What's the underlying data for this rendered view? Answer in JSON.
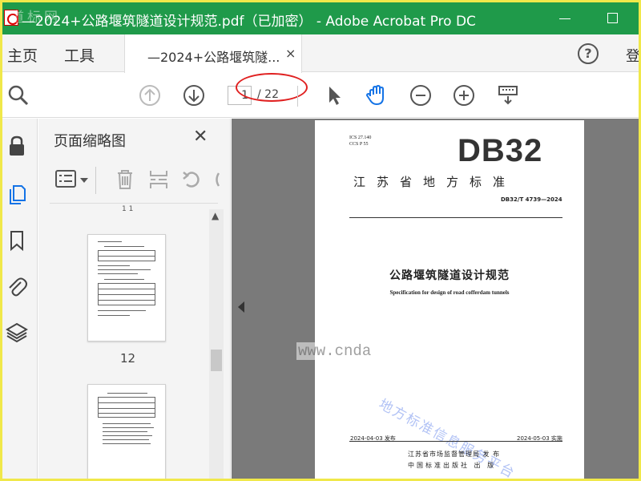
{
  "titlebar": {
    "watermark": "道标网",
    "title": "—2024+公路堰筑隧道设计规范.pdf（已加密） - Adobe Acrobat Pro DC"
  },
  "menu": {
    "home": "主页",
    "tools": "工具",
    "tab_label": "—2024+公路堰筑隧...",
    "tab_close": "×",
    "help": "?",
    "login": "登"
  },
  "toolbar": {
    "page_current": "1",
    "page_total": "/ 22",
    "icons": [
      "search-icon",
      "page-up-icon",
      "page-down-icon",
      "select-arrow-icon",
      "hand-tool-icon",
      "zoom-out-icon",
      "zoom-in-icon",
      "keyboard-icon"
    ]
  },
  "rail": {
    "icons": [
      "lock-icon",
      "page-thumbnails-icon",
      "bookmark-icon",
      "attachment-icon",
      "layers-icon"
    ]
  },
  "thumbnails": {
    "title": "页面缩略图",
    "close": "✕",
    "top_cut_label": "1 1",
    "page_label": "12"
  },
  "document": {
    "ics": "ICS 27.140",
    "ccs": "CCS P 55",
    "code": "DB32",
    "province": "江苏省地方标准",
    "standard_number": "DB32/T 4739—2024",
    "title_cn": "公路堰筑隧道设计规范",
    "title_en": "Specification for design of road cofferdam tunnels",
    "publish_date": "2024-04-03 发布",
    "implement_date": "2024-05-03 实施",
    "issuer_1": "江苏省市场监督管理局  发  布",
    "issuer_2": "中国标准出版社  出  版",
    "watermark": "地方标准信息服务平台"
  },
  "watermark_url": "www.cnda",
  "colors": {
    "titlebar": "#1f9a4a",
    "frame": "#f0e84a",
    "annotation": "#e02020",
    "selected_icon": "#1473e6"
  }
}
